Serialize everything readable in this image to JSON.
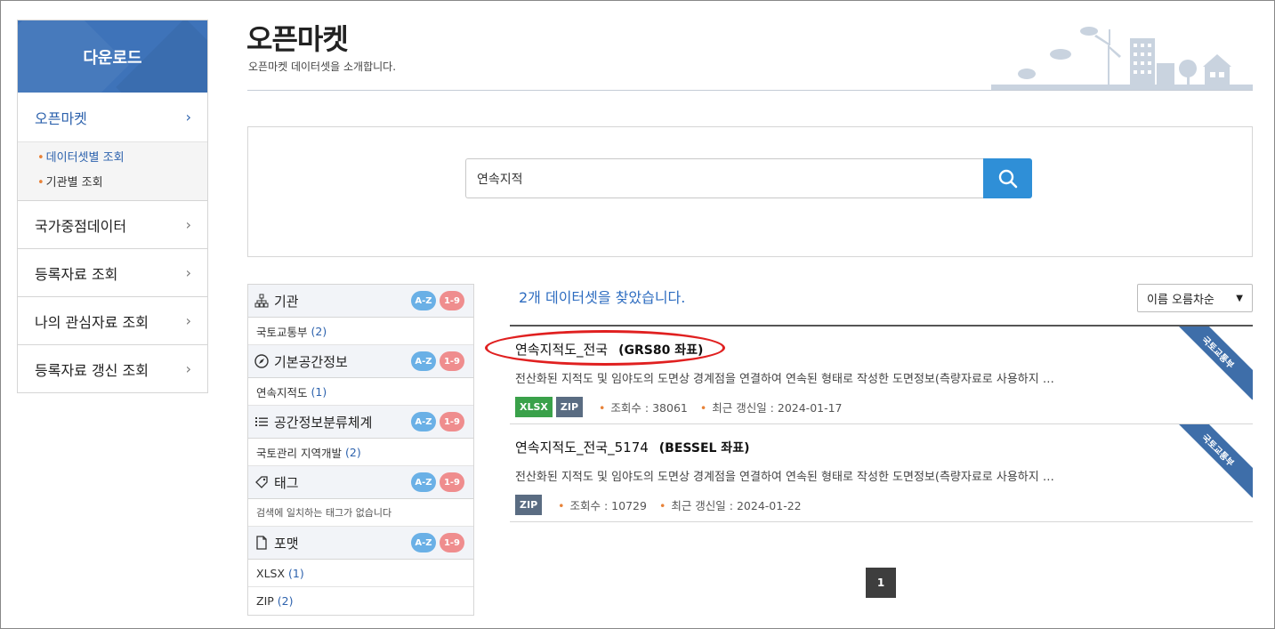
{
  "sidebar": {
    "title": "다운로드",
    "items": [
      {
        "label": "오픈마켓",
        "sub": [
          "데이터셋별 조회",
          "기관별 조회"
        ]
      },
      {
        "label": "국가중점데이터"
      },
      {
        "label": "등록자료 조회"
      },
      {
        "label": "나의 관심자료 조회"
      },
      {
        "label": "등록자료 갱신 조회"
      }
    ]
  },
  "header": {
    "title": "오픈마켓",
    "subtitle": "오픈마켓 데이터셋을 소개합니다."
  },
  "search": {
    "value": "연속지적"
  },
  "facets": {
    "az_label": "A-Z",
    "num_label": "1-9",
    "groups": [
      {
        "label": "기관",
        "icon": "org-chart-icon",
        "rows": [
          {
            "label": "국토교통부",
            "count": "(2)"
          }
        ]
      },
      {
        "label": "기본공간정보",
        "icon": "compass-icon",
        "rows": [
          {
            "label": "연속지적도",
            "count": "(1)"
          }
        ]
      },
      {
        "label": "공간정보분류체계",
        "icon": "list-icon",
        "rows": [
          {
            "label": "국토관리 지역개발",
            "count": "(2)"
          }
        ]
      },
      {
        "label": "태그",
        "icon": "tag-icon",
        "empty": "검색에 일치하는 태그가 없습니다"
      },
      {
        "label": "포맷",
        "icon": "file-icon",
        "rows": [
          {
            "label": "XLSX",
            "count": "(1)"
          },
          {
            "label": "ZIP",
            "count": "(2)"
          }
        ]
      }
    ]
  },
  "results": {
    "found_text": "2개 데이터셋을 찾았습니다.",
    "sort_label": "이름 오름차순",
    "items": [
      {
        "title": "연속지적도_전국",
        "crs": "(GRS80 좌표)",
        "description": "전산화된 지적도 및 임야도의 도면상 경계점을 연결하여 연속된 형태로 작성한 도면정보(측량자료로 사용하지 …",
        "formats": [
          "XLSX",
          "ZIP"
        ],
        "views": "조회수 : 38061",
        "updated": "최근 갱신일 : 2024-01-17",
        "ribbon": "국토교통부"
      },
      {
        "title": "연속지적도_전국_5174",
        "crs": "(BESSEL 좌표)",
        "description": "전산화된 지적도 및 임야도의 도면상 경계점을 연결하여 연속된 형태로 작성한 도면정보(측량자료로 사용하지 …",
        "formats": [
          "ZIP"
        ],
        "views": "조회수 : 10729",
        "updated": "최근 갱신일 : 2024-01-22",
        "ribbon": "국토교통부"
      }
    ]
  },
  "pagination": {
    "current": "1"
  },
  "colors": {
    "primary": "#3e73b9",
    "search_button": "#2f8fd7",
    "highlight_oval": "#e02020"
  }
}
